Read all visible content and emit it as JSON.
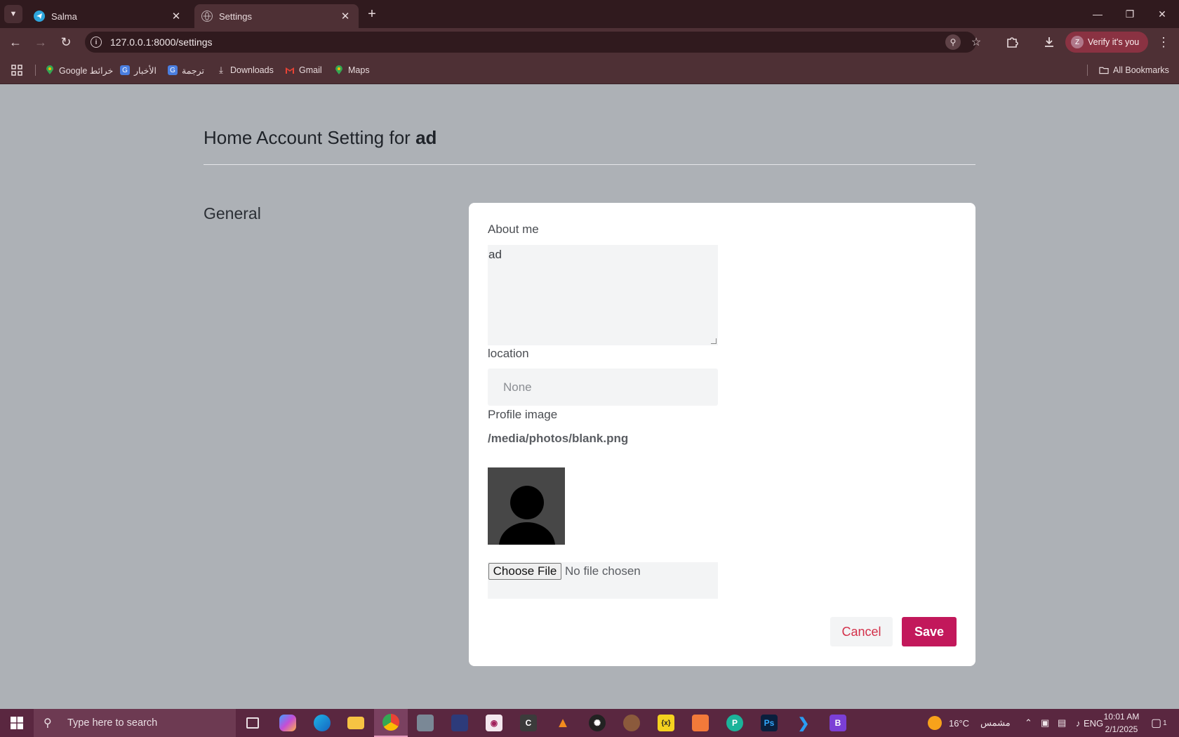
{
  "browser": {
    "tabs": [
      {
        "title": "Salma",
        "icon": "telegram-icon",
        "active": false
      },
      {
        "title": "Settings",
        "icon": "globe-icon",
        "active": true
      }
    ],
    "url": "127.0.0.1:8000/settings",
    "profile_label": "Verify it's you",
    "profile_initial": "Z",
    "bookmarks": [
      {
        "label": "Google خرائط",
        "icon": "maps-pin-icon"
      },
      {
        "label": "الأخبار",
        "icon": "news-icon"
      },
      {
        "label": "ترجمة",
        "icon": "translate-icon"
      },
      {
        "label": "Downloads",
        "icon": "download-icon"
      },
      {
        "label": "Gmail",
        "icon": "gmail-icon"
      },
      {
        "label": "Maps",
        "icon": "maps-pin-icon"
      }
    ],
    "all_bookmarks": "All Bookmarks"
  },
  "page": {
    "title_prefix": "Home Account Setting for",
    "username": "ad",
    "section": "General",
    "form": {
      "about_label": "About me",
      "about_value": "ad",
      "location_label": "location",
      "location_value": "None",
      "profile_image_label": "Profile image",
      "profile_image_path": "/media/photos/blank.png",
      "choose_file_label": "Choose File",
      "file_status": "No file chosen",
      "cancel_label": "Cancel",
      "save_label": "Save"
    }
  },
  "taskbar": {
    "search_placeholder": "Type here to search",
    "weather_temp": "16°C",
    "weather_desc": "مشمس",
    "language": "ENG",
    "time": "10:01 AM",
    "date": "2/1/2025",
    "notification_count": "1",
    "weather_badge": "1"
  },
  "colors": {
    "page_bg": "#adb1b6",
    "card_bg": "#ffffff",
    "save_button": "#c2185b",
    "cancel_text": "#d3304a",
    "browser_frame": "#301a1e",
    "browser_toolbar": "#4e3035",
    "taskbar": "#5a2740"
  }
}
